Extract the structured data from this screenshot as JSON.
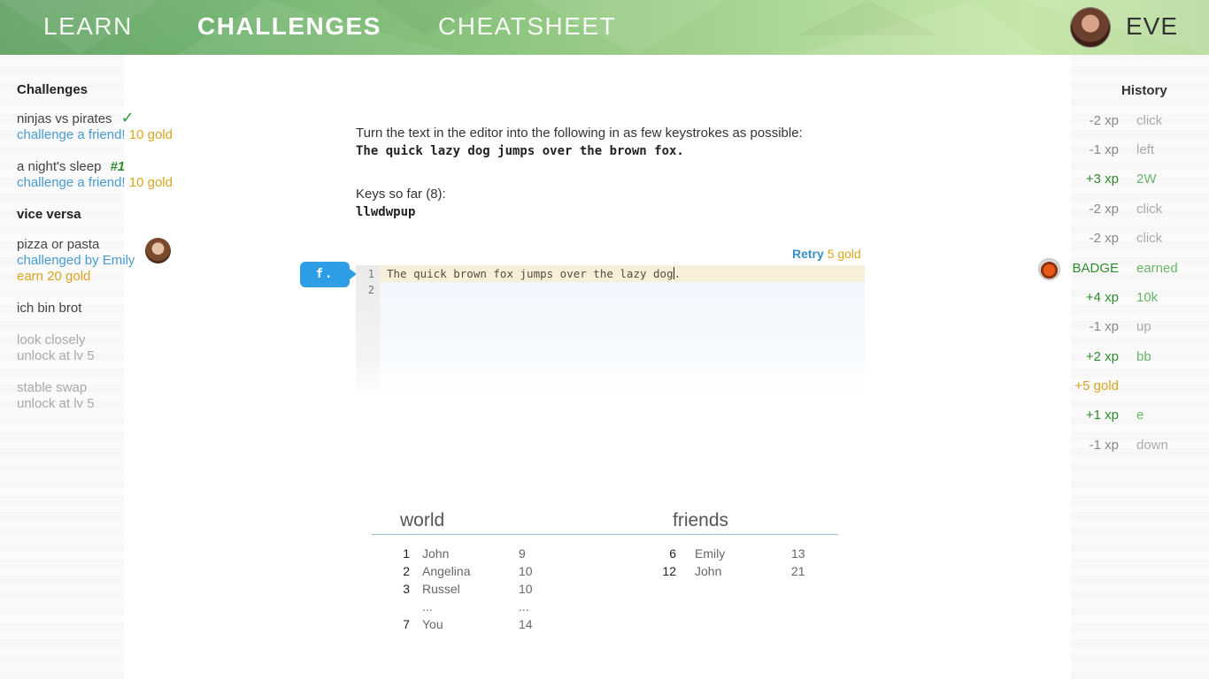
{
  "nav": {
    "learn": "LEARN",
    "challenges": "CHALLENGES",
    "cheatsheet": "CHEATSHEET",
    "username": "EVE"
  },
  "sidebar": {
    "title": "Challenges",
    "items": [
      {
        "name": "ninjas vs pirates",
        "check": "✓",
        "sub": "challenge a friend!",
        "gold": "10 gold"
      },
      {
        "name": "a night's sleep",
        "rank": "#1",
        "sub": "challenge a friend!",
        "gold": "10 gold"
      }
    ],
    "current": "vice versa",
    "pending": {
      "name": "pizza or pasta",
      "sub": "challenged by Emily",
      "reward": "earn 20 gold"
    },
    "plain": "ich bin brot",
    "locked": [
      {
        "name": "look closely",
        "sub": "unlock at lv 5"
      },
      {
        "name": "stable swap",
        "sub": "unlock at lv 5"
      }
    ]
  },
  "main": {
    "instruction": "Turn the text in the editor into the following in as few keystrokes as possible:",
    "target": "The quick lazy dog jumps over the brown fox.",
    "keys_label": "Keys so far (8):",
    "keys": "llwdwpup",
    "retry_label": "Retry",
    "retry_cost": "5 gold",
    "mode": "f.",
    "editor_line1": "The quick brown fox jumps over the lazy dog",
    "editor_line1_after": ".",
    "line_numbers": [
      "1",
      "2"
    ]
  },
  "leaderboard": {
    "world_title": "world",
    "friends_title": "friends",
    "world": [
      {
        "rank": "1",
        "name": "John",
        "score": "9"
      },
      {
        "rank": "2",
        "name": "Angelina",
        "score": "10"
      },
      {
        "rank": "3",
        "name": "Russel",
        "score": "10"
      },
      {
        "rank": "",
        "name": "...",
        "score": "..."
      },
      {
        "rank": "7",
        "name": "You",
        "score": "14"
      }
    ],
    "friends": [
      {
        "rank": "6",
        "name": "Emily",
        "score": "13"
      },
      {
        "rank": "12",
        "name": "John",
        "score": "21"
      }
    ]
  },
  "history": {
    "title": "History",
    "items": [
      {
        "value": "-2 xp",
        "action": "click",
        "kind": "neg"
      },
      {
        "value": "-1 xp",
        "action": "left",
        "kind": "neg"
      },
      {
        "value": "+3 xp",
        "action": "2W",
        "kind": "pos"
      },
      {
        "value": "-2 xp",
        "action": "click",
        "kind": "neg"
      },
      {
        "value": "-2 xp",
        "action": "click",
        "kind": "neg"
      },
      {
        "value": "BADGE",
        "action": "earned",
        "kind": "badge"
      },
      {
        "value": "+4 xp",
        "action": "10k",
        "kind": "pos"
      },
      {
        "value": "-1 xp",
        "action": "up",
        "kind": "neg"
      },
      {
        "value": "+2 xp",
        "action": "bb",
        "kind": "pos"
      },
      {
        "value": "+5 gold",
        "action": "",
        "kind": "gold"
      },
      {
        "value": "+1 xp",
        "action": "e",
        "kind": "pos"
      },
      {
        "value": "-1 xp",
        "action": "down",
        "kind": "neg"
      }
    ]
  },
  "colors": {
    "accent_blue": "#3a8fc9",
    "gold": "#d9a521",
    "positive": "#2e8a2e",
    "header_green": "#84c07a"
  }
}
